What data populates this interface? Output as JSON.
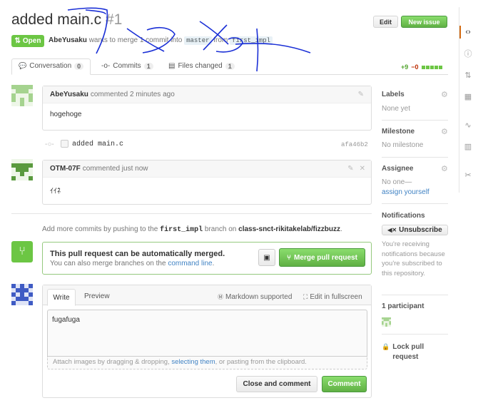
{
  "header": {
    "title": "added main.c",
    "number": "#1",
    "edit_label": "Edit",
    "new_issue_label": "New issue",
    "state_label": "Open",
    "author": "AbeYusaku",
    "meta_text_1": "wants to merge 1 commit into",
    "base_branch": "master",
    "meta_text_2": "from",
    "head_branch": "first_impl"
  },
  "tabs": [
    {
      "label": "Conversation",
      "count": "0"
    },
    {
      "label": "Commits",
      "count": "1"
    },
    {
      "label": "Files changed",
      "count": "1"
    }
  ],
  "diffstat": {
    "additions": "+9",
    "deletions": "−0"
  },
  "timeline": {
    "comment1": {
      "author": "AbeYusaku",
      "action": "commented 2 minutes ago",
      "body": "hogehoge"
    },
    "commit": {
      "message": "added main.c",
      "sha": "afa46b2"
    },
    "comment2": {
      "author": "OTM-07F",
      "action": "commented just now",
      "body": "ｲｲﾈ"
    },
    "push_hint": {
      "prefix": "Add more commits by pushing to the",
      "branch": "first_impl",
      "middle": "branch on",
      "repo": "class-snct-rikitakelab/fizzbuzz",
      "suffix": "."
    }
  },
  "merge": {
    "title": "This pull request can be automatically merged.",
    "subtitle_prefix": "You can also merge branches on the",
    "subtitle_link": "command line",
    "subtitle_suffix": ".",
    "button_label": "Merge pull request"
  },
  "composer": {
    "tab_write": "Write",
    "tab_preview": "Preview",
    "markdown_label": "Markdown supported",
    "fullscreen_label": "Edit in fullscreen",
    "textarea_value": "fugafuga",
    "attach_prefix": "Attach images by dragging & dropping,",
    "attach_link": "selecting them",
    "attach_suffix": ", or pasting from the clipboard.",
    "close_comment_label": "Close and comment",
    "comment_label": "Comment"
  },
  "sidebar": {
    "labels_title": "Labels",
    "labels_value": "None yet",
    "milestone_title": "Milestone",
    "milestone_value": "No milestone",
    "assignee_title": "Assignee",
    "assignee_value": "No one—",
    "assignee_link": "assign yourself",
    "notifications_title": "Notifications",
    "unsubscribe_label": "Unsubscribe",
    "notifications_text": "You're receiving notifications because you're subscribed to this repository.",
    "participants_title": "1 participant",
    "lock_label": "Lock pull request"
  },
  "colors": {
    "green": "#6cc644",
    "link": "#4183c4",
    "annotation": "#1a2fd6"
  },
  "icons": [
    "code-icon",
    "issue-icon",
    "pull-request-icon",
    "wiki-icon",
    "pulse-icon",
    "graph-icon",
    "settings-icon"
  ]
}
